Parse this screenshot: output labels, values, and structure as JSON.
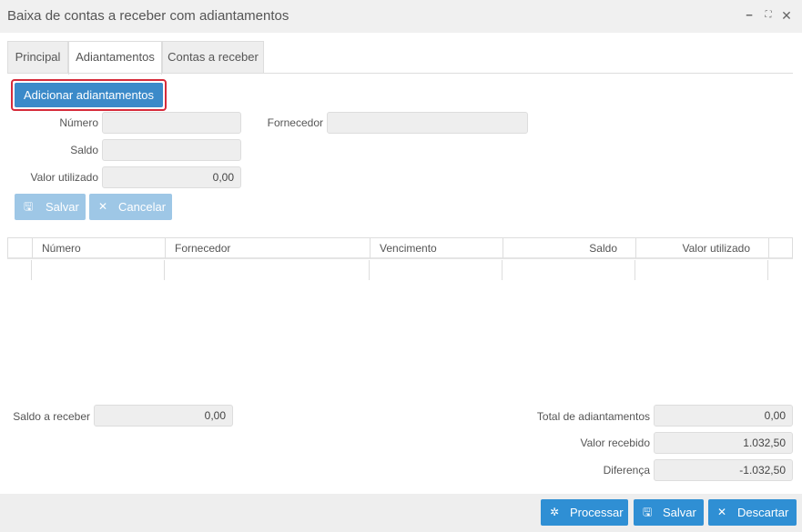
{
  "window": {
    "title": "Baixa de contas a receber com adiantamentos",
    "minimize": "−",
    "maximize": "⛶",
    "close": "✕"
  },
  "tabs": [
    {
      "label": "Principal",
      "active": false
    },
    {
      "label": "Adiantamentos",
      "active": true
    },
    {
      "label": "Contas a receber",
      "active": false
    }
  ],
  "form": {
    "add_button": "Adicionar adiantamentos",
    "numero_label": "Número",
    "numero_value": "",
    "fornecedor_label": "Fornecedor",
    "fornecedor_value": "",
    "saldo_label": "Saldo",
    "saldo_value": "",
    "valor_utilizado_label": "Valor utilizado",
    "valor_utilizado_value": "0,00",
    "save_label": "Salvar",
    "cancel_label": "Cancelar"
  },
  "grid": {
    "columns": [
      "Número",
      "Fornecedor",
      "Vencimento",
      "Saldo",
      "Valor utilizado"
    ],
    "rows": []
  },
  "summary": {
    "saldo_a_receber_label": "Saldo a receber",
    "saldo_a_receber_value": "0,00",
    "total_adiantamentos_label": "Total de adiantamentos",
    "total_adiantamentos_value": "0,00",
    "valor_recebido_label": "Valor recebido",
    "valor_recebido_value": "1.032,50",
    "diferenca_label": "Diferença",
    "diferenca_value": "-1.032,50"
  },
  "footer": {
    "processar_label": "Processar",
    "salvar_label": "Salvar",
    "descartar_label": "Descartar"
  },
  "colors": {
    "primary": "#2f8fd4",
    "add_button": "#3b8ac9",
    "highlight_border": "#d62b3a",
    "disabled_button": "#9ec7e6"
  }
}
